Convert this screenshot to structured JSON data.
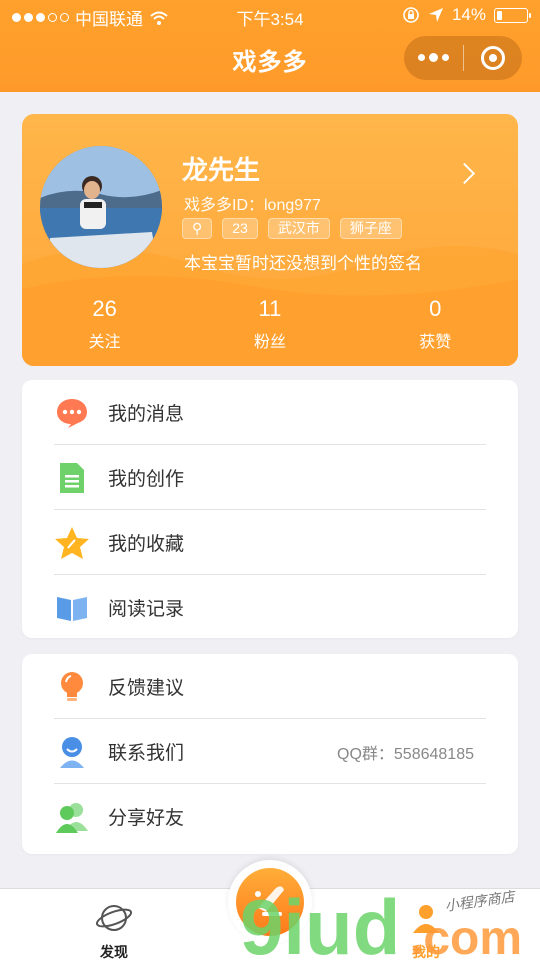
{
  "status_bar": {
    "carrier": "中国联通",
    "time": "下午3:54",
    "battery": "14%"
  },
  "nav": {
    "title": "戏多多"
  },
  "profile": {
    "name": "龙先生",
    "id_line": "戏多多ID：long977",
    "tags": [
      "⚲",
      "23",
      "武汉市",
      "狮子座"
    ],
    "signature": "本宝宝暂时还没想到个性的签名",
    "stats": [
      {
        "num": "26",
        "label": "关注"
      },
      {
        "num": "11",
        "label": "粉丝"
      },
      {
        "num": "0",
        "label": "获赞"
      }
    ]
  },
  "menu1": [
    {
      "label": "我的消息",
      "icon": "chat-bubble-icon"
    },
    {
      "label": "我的创作",
      "icon": "document-icon"
    },
    {
      "label": "我的收藏",
      "icon": "star-icon"
    },
    {
      "label": "阅读记录",
      "icon": "book-icon"
    }
  ],
  "menu2": [
    {
      "label": "反馈建议",
      "icon": "lightbulb-icon"
    },
    {
      "label": "联系我们",
      "icon": "contact-icon",
      "extra": "QQ群：558648185"
    },
    {
      "label": "分享好友",
      "icon": "friends-icon"
    }
  ],
  "tabbar": {
    "discover": "发现",
    "me": "我的"
  },
  "watermark": {
    "brand": "9iud",
    "suffix": ".com",
    "tagline": "小程序商店"
  },
  "colors": {
    "accent": "#ff9f2c",
    "card_orange": "#ffab40"
  }
}
